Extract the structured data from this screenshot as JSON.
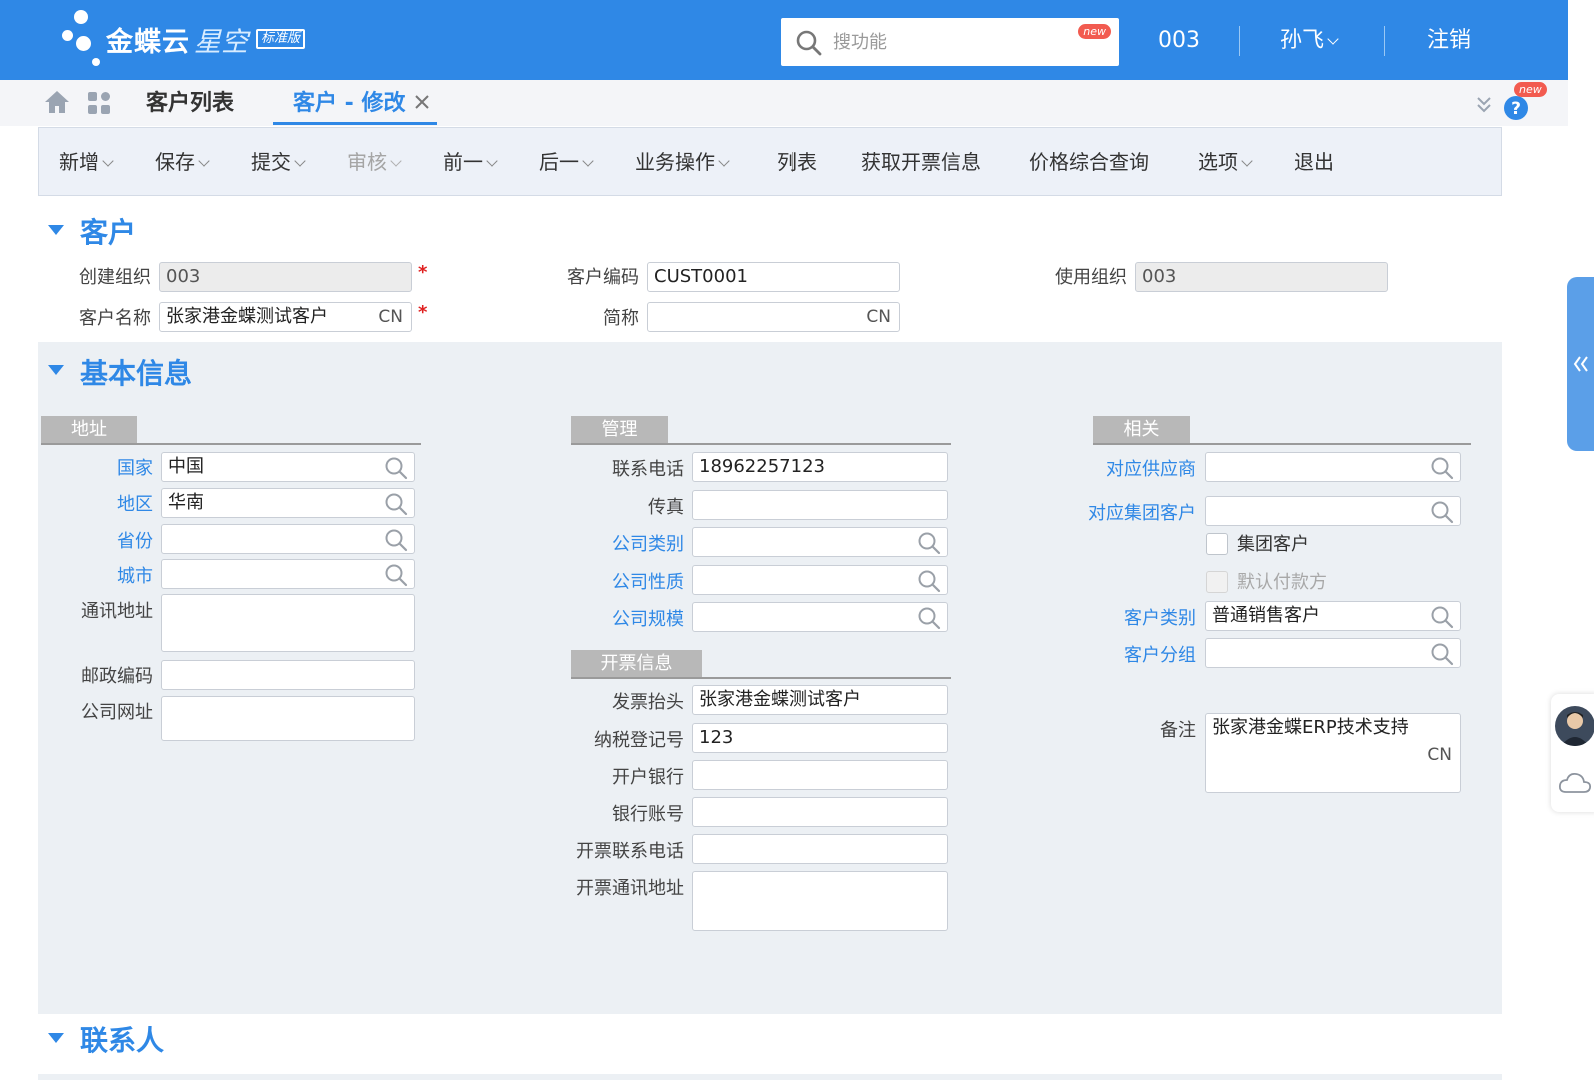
{
  "header": {
    "logo_text": "金蝶云",
    "logo_sub": "星空",
    "logo_badge": "标准版",
    "search_placeholder": "搜功能",
    "search_badge": "new",
    "org": "003",
    "user": "孙飞",
    "logout": "注销",
    "accent_color": "#2f88e6"
  },
  "tabs": {
    "list": "客户列表",
    "edit": "客户 - 修改",
    "help_badge": "new"
  },
  "toolbar": {
    "add": "新增",
    "save": "保存",
    "submit": "提交",
    "audit": "审核",
    "prev": "前一",
    "next": "后一",
    "business": "业务操作",
    "list": "列表",
    "invoice_info": "获取开票信息",
    "price_query": "价格综合查询",
    "options": "选项",
    "exit": "退出"
  },
  "customer": {
    "title": "客户",
    "create_org_label": "创建组织",
    "create_org": "003",
    "code_label": "客户编码",
    "code": "CUST0001",
    "use_org_label": "使用组织",
    "use_org": "003",
    "name_label": "客户名称",
    "name": "张家港金蝶测试客户",
    "name_lang": "CN",
    "short_label": "简称",
    "short": "",
    "short_lang": "CN",
    "required_mark": "*"
  },
  "basic": {
    "title": "基本信息",
    "address": {
      "group": "地址",
      "country_label": "国家",
      "country": "中国",
      "region_label": "地区",
      "region": "华南",
      "province_label": "省份",
      "province": "",
      "city_label": "城市",
      "city": "",
      "mail_address_label": "通讯地址",
      "mail_address": "",
      "zip_label": "邮政编码",
      "zip": "",
      "website_label": "公司网址",
      "website": ""
    },
    "management": {
      "group": "管理",
      "phone_label": "联系电话",
      "phone": "18962257123",
      "fax_label": "传真",
      "fax": "",
      "company_type_label": "公司类别",
      "company_type": "",
      "company_nature_label": "公司性质",
      "company_nature": "",
      "company_scale_label": "公司规模",
      "company_scale": ""
    },
    "invoice": {
      "group": "开票信息",
      "title_label": "发票抬头",
      "title": "张家港金蝶测试客户",
      "tax_no_label": "纳税登记号",
      "tax_no": "123",
      "bank_label": "开户银行",
      "bank": "",
      "account_label": "银行账号",
      "account": "",
      "inv_phone_label": "开票联系电话",
      "inv_phone": "",
      "inv_address_label": "开票通讯地址",
      "inv_address": ""
    },
    "related": {
      "group": "相关",
      "supplier_label": "对应供应商",
      "supplier": "",
      "group_customer_label": "对应集团客户",
      "group_customer": "",
      "is_group_label": "集团客户",
      "default_payer_label": "默认付款方",
      "category_label": "客户类别",
      "category": "普通销售客户",
      "grouping_label": "客户分组",
      "grouping": "",
      "remark_label": "备注",
      "remark": "张家港金蝶ERP技术支持",
      "remark_lang": "CN"
    }
  },
  "contacts": {
    "title": "联系人"
  }
}
